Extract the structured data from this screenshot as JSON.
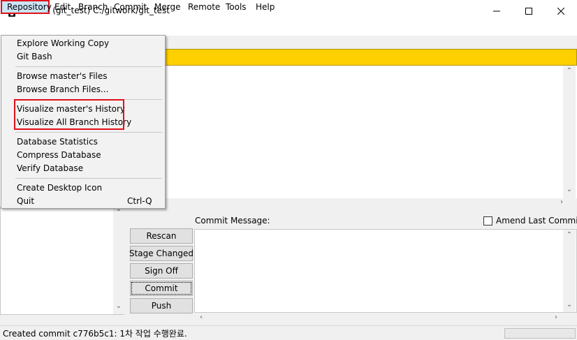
{
  "window": {
    "title": "Git Gui (git_test) C:/gitwork/git_test"
  },
  "menubar": {
    "items": [
      "Repository",
      "Edit",
      "Branch",
      "Commit",
      "Merge",
      "Remote",
      "Tools",
      "Help"
    ]
  },
  "repository_menu": {
    "explore": "Explore Working Copy",
    "git_bash": "Git Bash",
    "browse_master": "Browse master's Files",
    "browse_branch": "Browse Branch Files...",
    "visualize_master": "Visualize master's History",
    "visualize_all": "Visualize All Branch History",
    "db_stats": "Database Statistics",
    "compress_db": "Compress Database",
    "verify_db": "Verify Database",
    "desktop_icon": "Create Desktop Icon",
    "quit": "Quit",
    "quit_shortcut": "Ctrl-Q"
  },
  "commit_panel": {
    "message_label": "Commit Message:",
    "amend_label": "Amend Last Commit",
    "amend_checked": false,
    "buttons": {
      "rescan": "Rescan",
      "stage_changed": "Stage Changed",
      "sign_off": "Sign Off",
      "commit": "Commit",
      "push": "Push"
    }
  },
  "status": {
    "text": "Created commit c776b5c1: 1차 작업 수행완료."
  },
  "colors": {
    "diff_header": "#ffd000",
    "menu_highlight": "#cce4f7",
    "annotation_red": "#e0101a"
  }
}
